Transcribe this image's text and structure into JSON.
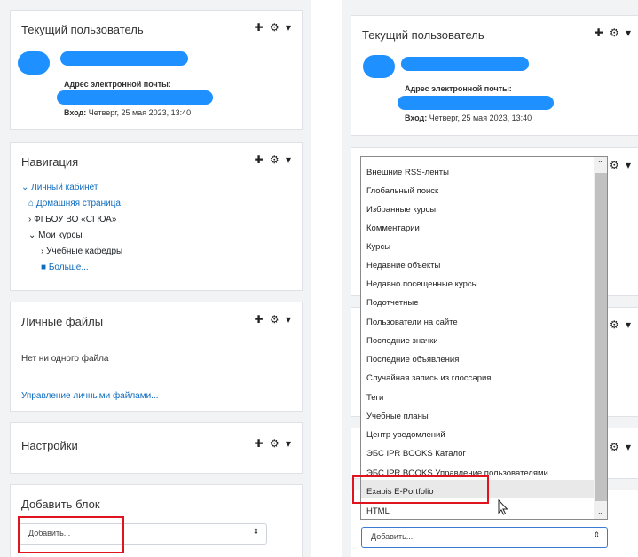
{
  "left": {
    "current_user": {
      "title": "Текущий пользователь",
      "email_label": "Адрес электронной почты:",
      "login_label": "Вход:",
      "login_value": "Четверг, 25 мая 2023, 13:40"
    },
    "navigation": {
      "title": "Навигация",
      "items": [
        {
          "label": "Личный кабинет",
          "icon": "chevron-down-icon"
        },
        {
          "label": "Домашняя страница",
          "icon": "home-icon"
        },
        {
          "label": "ФГБОУ ВО «СГЮА»",
          "icon": "chevron-right-icon"
        },
        {
          "label": "Мои курсы",
          "icon": "chevron-down-icon"
        },
        {
          "label": "Учебные кафедры",
          "icon": "chevron-right-icon"
        },
        {
          "label": "Больше...",
          "icon": "square-icon"
        }
      ]
    },
    "private_files": {
      "title": "Личные файлы",
      "empty": "Нет ни одного файла",
      "manage_link": "Управление личными файлами..."
    },
    "settings": {
      "title": "Настройки"
    },
    "add_block": {
      "title": "Добавить блок",
      "select_value": "Добавить..."
    }
  },
  "right": {
    "current_user": {
      "title": "Текущий пользователь",
      "email_label": "Адрес электронной почты:",
      "login_label": "Вход:",
      "login_value": "Четверг, 25 мая 2023, 13:40"
    },
    "dropdown": {
      "options": [
        "Внешние RSS-ленты",
        "Глобальный поиск",
        "Избранные курсы",
        "Комментарии",
        "Курсы",
        "Недавние объекты",
        "Недавно посещенные курсы",
        "Подотчетные",
        "Пользователи на сайте",
        "Последние значки",
        "Последние объявления",
        "Случайная запись из глоссария",
        "Теги",
        "Учебные планы",
        "Центр уведомлений",
        "ЭБС IPR BOOKS Каталог",
        "ЭБС IPR BOOKS Управление пользователями",
        "Exabis E-Portfolio",
        "HTML"
      ],
      "highlighted": "Exabis E-Portfolio"
    },
    "select_value": "Добавить..."
  },
  "icons": {
    "move": "move-icon",
    "gear": "gear-icon",
    "caret": "caret-down-icon"
  },
  "colors": {
    "accent_link": "#0f6cbf",
    "redaction": "#1e90ff",
    "highlight_box": "#e0141e"
  }
}
